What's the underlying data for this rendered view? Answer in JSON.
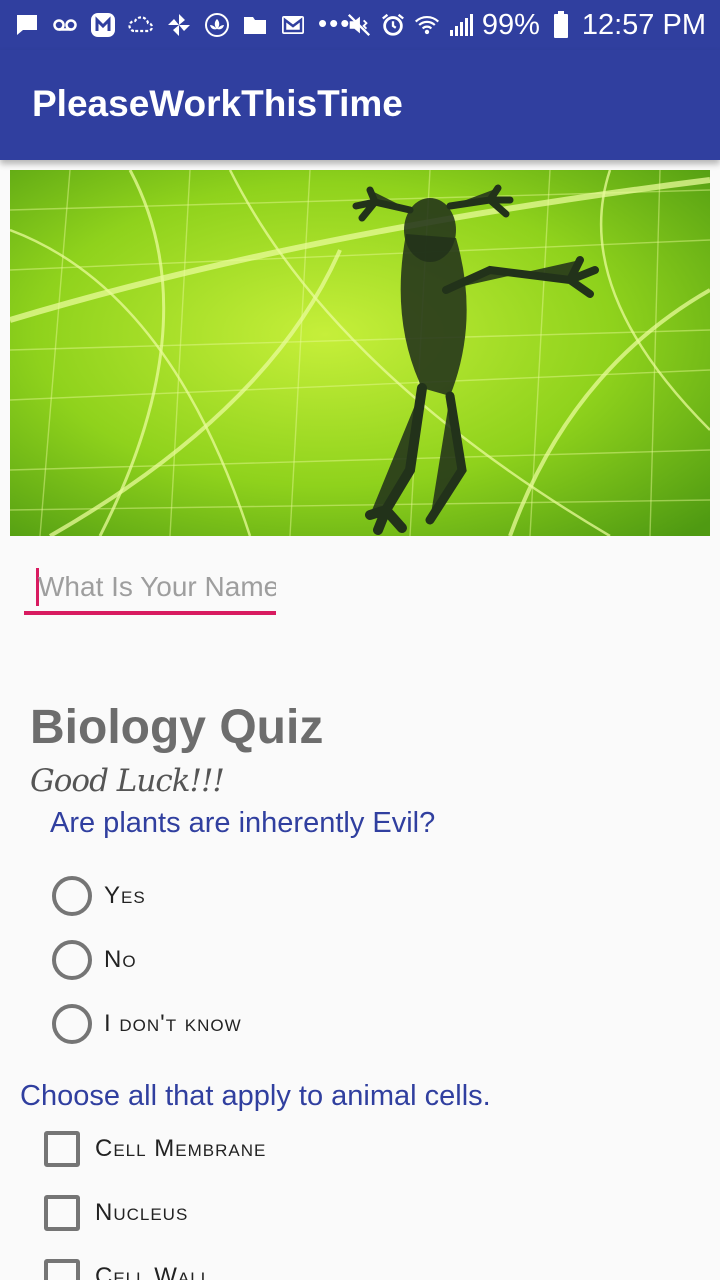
{
  "status_bar": {
    "battery": "99%",
    "time": "12:57 PM",
    "overflow": "•••"
  },
  "app_bar": {
    "title": "PleaseWorkThisTime"
  },
  "name_field": {
    "placeholder": "What Is Your Name?"
  },
  "quiz": {
    "title": "Biology Quiz",
    "subtitle": "Good Luck!!!"
  },
  "question1": {
    "text": "Are plants are inherently Evil?",
    "options": [
      "Yes",
      "No",
      "I don't know"
    ]
  },
  "question2": {
    "text": "Choose all that apply to animal cells.",
    "options": [
      "Cell Membrane",
      "Nucleus",
      "Cell Wall"
    ]
  },
  "colors": {
    "primary": "#303f9f",
    "accent": "#d81b60"
  }
}
